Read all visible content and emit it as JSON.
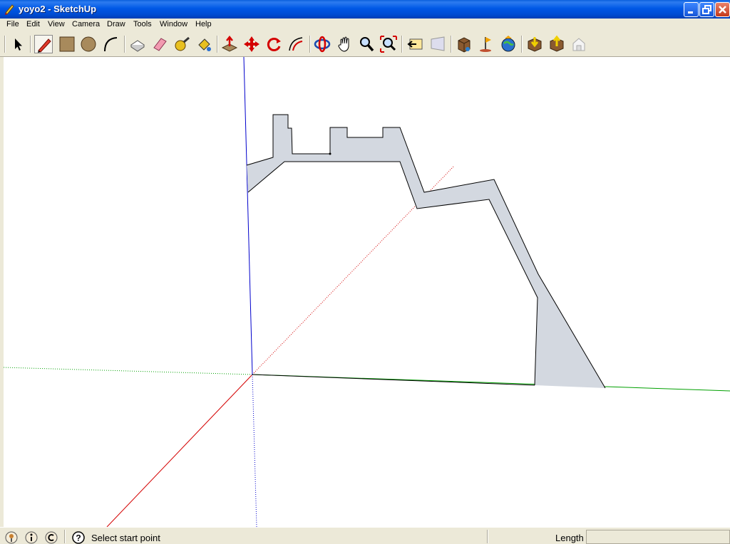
{
  "window": {
    "title": "yoyo2 - SketchUp"
  },
  "menu": [
    "File",
    "Edit",
    "View",
    "Camera",
    "Draw",
    "Tools",
    "Window",
    "Help"
  ],
  "toolbar": {
    "tools": [
      "select-tool",
      "pencil-tool",
      "rectangle-tool",
      "circle-tool",
      "arc-tool",
      "make-component-tool",
      "eraser-tool",
      "tape-measure-tool",
      "paint-bucket-tool",
      "push-pull-tool",
      "move-tool",
      "rotate-tool",
      "offset-tool",
      "orbit-tool",
      "pan-tool",
      "zoom-tool",
      "zoom-extents-tool",
      "previous-view-tool",
      "next-view-tool",
      "3d-warehouse-tool",
      "add-location-tool",
      "google-earth-tool",
      "get-models-tool",
      "share-model-tool",
      "send-to-layout-tool"
    ],
    "active_tool": "pencil-tool"
  },
  "status": {
    "message": "Select start point",
    "vcb_label": "Length",
    "vcb_value": ""
  },
  "colors": {
    "axis_red": "#d40000",
    "axis_green": "#00a000",
    "axis_blue": "#0000cc",
    "face_fill": "#d3d8e0",
    "edge": "#000000"
  }
}
